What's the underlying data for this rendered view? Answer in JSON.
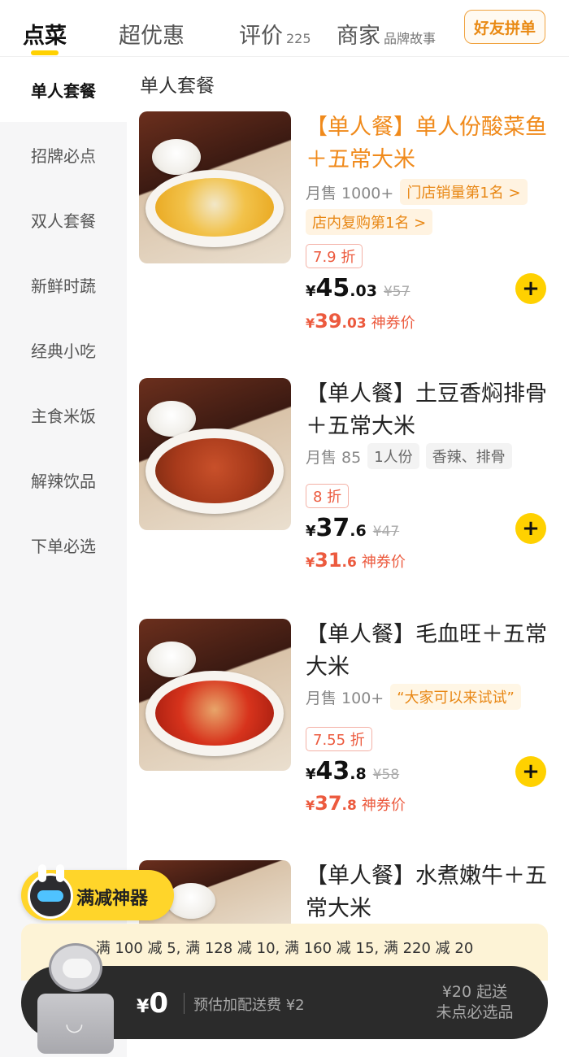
{
  "tabs": [
    {
      "label": "点菜",
      "sub": ""
    },
    {
      "label": "超优惠",
      "sub": ""
    },
    {
      "label": "评价",
      "sub": "225"
    },
    {
      "label": "商家",
      "sub": "品牌故事"
    }
  ],
  "group_order_label": "好友拼单",
  "sidebar": {
    "items": [
      {
        "label": "单人套餐"
      },
      {
        "label": "招牌必点"
      },
      {
        "label": "双人套餐"
      },
      {
        "label": "新鲜时蔬"
      },
      {
        "label": "经典小吃"
      },
      {
        "label": "主食米饭"
      },
      {
        "label": "解辣饮品"
      },
      {
        "label": "下单必选"
      }
    ]
  },
  "section_title": "单人套餐",
  "dishes": [
    {
      "name": "【单人餐】单人份酸菜鱼＋五常大米",
      "sales": "月售 1000+",
      "tags": [
        "门店销量第1名 >",
        "店内复购第1名 >"
      ],
      "discount": "7.9 折",
      "price_int": "45",
      "price_dec": ".03",
      "original_price": "¥57",
      "coupon_int": "39",
      "coupon_dec": ".03",
      "coupon_label": "神券价"
    },
    {
      "name": "【单人餐】土豆香焖排骨＋五常大米",
      "sales": "月售 85",
      "tags": [
        "1人份",
        "香辣、排骨"
      ],
      "discount": "8 折",
      "price_int": "37",
      "price_dec": ".6",
      "original_price": "¥47",
      "coupon_int": "31",
      "coupon_dec": ".6",
      "coupon_label": "神券价"
    },
    {
      "name": "【单人餐】毛血旺＋五常大米",
      "sales": "月售 100+",
      "tags": [
        "“大家可以来试试”"
      ],
      "discount": "7.55 折",
      "price_int": "43",
      "price_dec": ".8",
      "original_price": "¥58",
      "coupon_int": "37",
      "coupon_dec": ".8",
      "coupon_label": "神券价"
    },
    {
      "name": "【单人餐】水煮嫩牛＋五常大米"
    }
  ],
  "currency": "¥",
  "promo_badge_label": "满减神器",
  "full_reduction": "满 100 减 5, 满 128 减 10, 满 160 减 15, 满 220 减 20",
  "cart": {
    "total": "0",
    "delivery_fee": "预估加配送费 ¥2",
    "min_order_line1": "¥20 起送",
    "min_order_line2": "未点必选品"
  },
  "colors": {
    "accent": "#ffd100",
    "price_red": "#ec5a3e",
    "tag_orange": "#e88714"
  },
  "icons": [
    "plus-icon",
    "robot-mascot-icon"
  ]
}
